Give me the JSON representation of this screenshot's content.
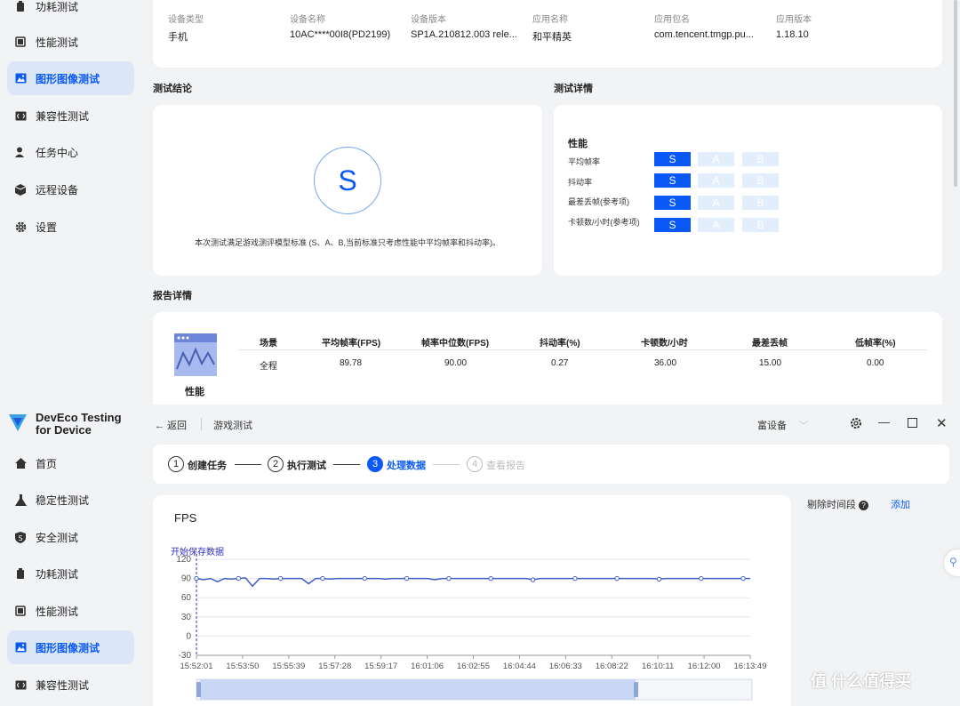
{
  "sidebar_top": {
    "items": [
      {
        "label": "功耗测试"
      },
      {
        "label": "性能测试"
      },
      {
        "label": "图形图像测试"
      },
      {
        "label": "兼容性测试"
      },
      {
        "label": "任务中心"
      },
      {
        "label": "远程设备"
      },
      {
        "label": "设置"
      }
    ]
  },
  "brand": {
    "line1": "DevEco Testing",
    "line2": "for Device"
  },
  "sidebar_bot": {
    "items": [
      {
        "label": "首页"
      },
      {
        "label": "稳定性测试"
      },
      {
        "label": "安全测试"
      },
      {
        "label": "功耗测试"
      },
      {
        "label": "性能测试"
      },
      {
        "label": "图形图像测试"
      },
      {
        "label": "兼容性测试"
      }
    ]
  },
  "device_info": {
    "fields": [
      {
        "label": "设备类型",
        "value": "手机"
      },
      {
        "label": "设备名称",
        "value": "10AC****00I8(PD2199)"
      },
      {
        "label": "设备版本",
        "value": "SP1A.210812.003 rele..."
      },
      {
        "label": "应用名称",
        "value": "和平精英"
      },
      {
        "label": "应用包名",
        "value": "com.tencent.tmgp.pu..."
      },
      {
        "label": "应用版本",
        "value": "1.18.10"
      }
    ]
  },
  "conclusion": {
    "title": "测试结论",
    "grade": "S",
    "note": "本次测试满足游戏测评模型标准 (S、A、B,当前标准只考虑性能中平均帧率和抖动率)。"
  },
  "details": {
    "title": "测试详情",
    "section": "性能",
    "rows": [
      {
        "label": "平均帧率",
        "grades": [
          "S",
          "A",
          "B"
        ],
        "selected": 0
      },
      {
        "label": "抖动率",
        "grades": [
          "S",
          "A",
          "B"
        ],
        "selected": 0
      },
      {
        "label": "最差丢帧(参考项)",
        "grades": [
          "S",
          "A",
          "B"
        ],
        "selected": 0
      },
      {
        "label": "卡顿数/小时(参考项)",
        "grades": [
          "S",
          "A",
          "B"
        ],
        "selected": 0
      }
    ]
  },
  "report": {
    "title": "报告详情",
    "category": "性能",
    "headers": [
      "场景",
      "平均帧率(FPS)",
      "帧率中位数(FPS)",
      "抖动率(%)",
      "卡顿数/小时",
      "最差丢帧",
      "低帧率(%)"
    ],
    "row": [
      "全程",
      "89.78",
      "90.00",
      "0.27",
      "36.00",
      "15.00",
      "0.00"
    ]
  },
  "topbar": {
    "back": "返回",
    "title": "游戏测试",
    "device": "富设备"
  },
  "steps": [
    {
      "num": "1",
      "label": "创建任务"
    },
    {
      "num": "2",
      "label": "执行测试"
    },
    {
      "num": "3",
      "label": "处理数据"
    },
    {
      "num": "4",
      "label": "查看报告"
    }
  ],
  "right_panel": {
    "label": "剔除时间段",
    "add": "添加"
  },
  "watermark": "值 什么值得买",
  "chart_data": {
    "type": "line",
    "title": "FPS",
    "annotation": "开始保存数据",
    "ylim": [
      -30,
      120
    ],
    "y_ticks": [
      "120",
      "90",
      "60",
      "30",
      "0",
      "-30"
    ],
    "x_ticks": [
      "15:52:01",
      "15:53:50",
      "15:55:39",
      "15:57:28",
      "15:59:17",
      "16:01:06",
      "16:02:55",
      "16:04:44",
      "16:06:33",
      "16:08:22",
      "16:10:11",
      "16:12:00",
      "16:13:49"
    ],
    "series": [
      {
        "values": [
          90,
          88,
          90,
          85,
          90,
          89,
          90,
          91,
          78,
          90,
          90,
          89,
          90,
          90,
          90,
          90,
          82,
          90,
          90,
          89,
          90,
          90,
          90,
          90,
          90,
          90,
          90,
          89,
          90,
          90,
          90,
          90,
          90,
          90,
          88,
          90,
          90,
          90,
          90,
          90,
          90,
          90,
          90,
          90,
          90,
          90,
          90,
          90,
          88,
          90,
          90,
          90,
          90,
          90,
          90,
          90,
          90,
          90,
          90,
          90,
          90,
          90,
          90,
          90,
          90,
          90,
          89,
          90,
          90,
          90,
          90,
          90,
          90,
          90,
          90,
          90,
          90,
          90,
          90,
          90
        ]
      }
    ],
    "grid": true,
    "accent": "#3f5fc8"
  }
}
